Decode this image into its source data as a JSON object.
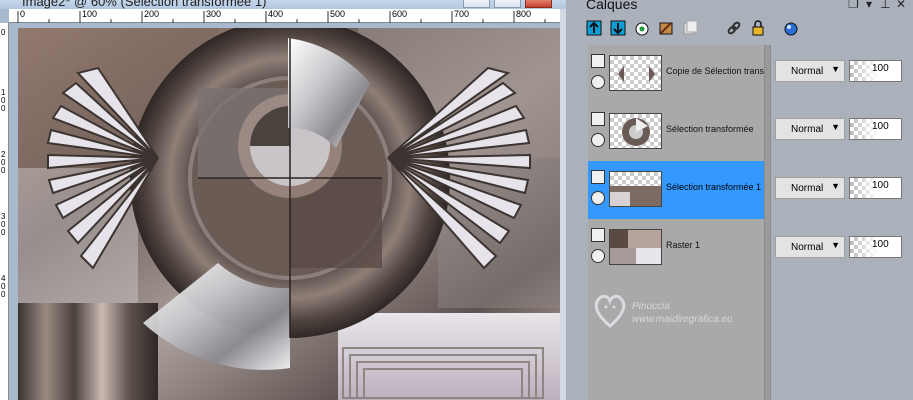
{
  "image_window": {
    "title": "Image2* @ 60% (Sélection transformée 1)",
    "ruler_top": [
      "0",
      "100",
      "200",
      "300",
      "400",
      "500",
      "600",
      "700",
      "800"
    ],
    "ruler_left": [
      "0",
      "1 0 0",
      "2 0 0",
      "3 0 0",
      "4 0 0"
    ]
  },
  "layers_palette": {
    "title": "Calques",
    "tools": [
      "new-raster-layer-icon",
      "new-vector-layer-icon",
      "new-adjustment-layer-icon",
      "new-mask-layer-icon",
      "duplicate-layer-icon",
      "link-icon",
      "lock-icon",
      "layer-properties-icon"
    ],
    "layers": [
      {
        "name": "Copie de Sélection transformée",
        "blend": "Normal",
        "opacity": "100",
        "selected": false
      },
      {
        "name": "Sélection transformée",
        "blend": "Normal",
        "opacity": "100",
        "selected": false
      },
      {
        "name": "Sélection transformée 1",
        "blend": "Normal",
        "opacity": "100",
        "selected": true
      },
      {
        "name": "Raster 1",
        "blend": "Normal",
        "opacity": "100",
        "selected": false
      }
    ],
    "colors": {
      "selected": "#3399ff",
      "panel": "#a9a9a9"
    }
  },
  "watermark": {
    "name": "Pinuccia",
    "url": "www.maidiregrafica.eu"
  }
}
